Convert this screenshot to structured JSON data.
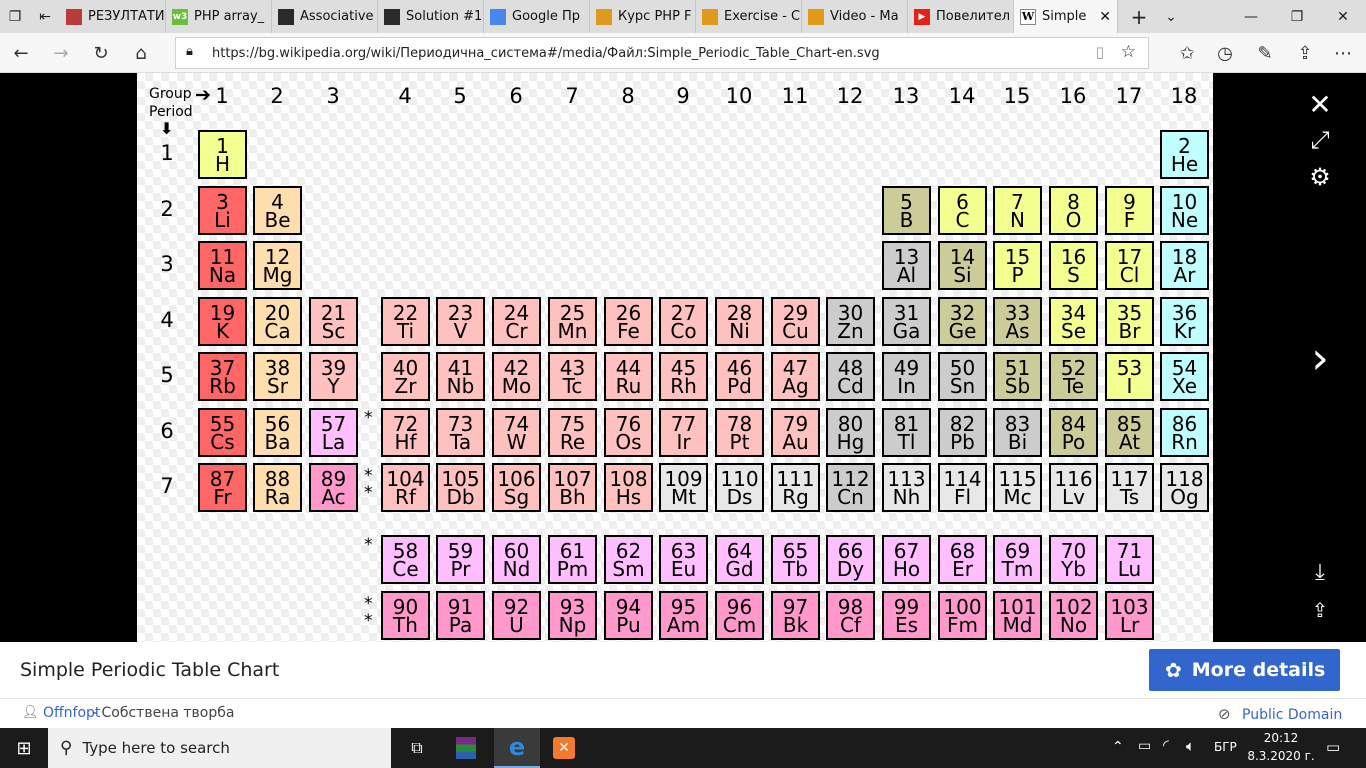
{
  "browser": {
    "tabs": [
      {
        "label": "РЕЗУЛТАТИ",
        "color": "#ba3b3b",
        "glyph": ""
      },
      {
        "label": "PHP array_",
        "color": "#6bbd3e",
        "glyph": "w3"
      },
      {
        "label": "Associative",
        "color": "#2a2a2a",
        "glyph": ""
      },
      {
        "label": "Solution #1",
        "color": "#2a2a2a",
        "glyph": ""
      },
      {
        "label": "Google Пр",
        "color": "#4a86e8",
        "glyph": ""
      },
      {
        "label": "Курс PHP F",
        "color": "#e09a1b",
        "glyph": ""
      },
      {
        "label": "Exercise - С",
        "color": "#e09a1b",
        "glyph": ""
      },
      {
        "label": "Video - Ма",
        "color": "#e09a1b",
        "glyph": ""
      },
      {
        "label": "Повелител",
        "color": "#e62117",
        "glyph": "▶"
      }
    ],
    "active_tab": {
      "label": "Simple",
      "glyph": "W"
    },
    "url": "https://bg.wikipedia.org/wiki/Периодична_система#/media/Файл:Simple_Periodic_Table_Chart-en.svg"
  },
  "table": {
    "group_label": "Group",
    "period_label": "Period",
    "groups": [
      "1",
      "2",
      "3",
      "4",
      "5",
      "6",
      "7",
      "8",
      "9",
      "10",
      "11",
      "12",
      "13",
      "14",
      "15",
      "16",
      "17",
      "18"
    ],
    "periods": [
      "1",
      "2",
      "3",
      "4",
      "5",
      "6",
      "7"
    ],
    "elements": [
      {
        "n": "1",
        "s": "H",
        "g": 1,
        "p": 1,
        "c": "#f3ff8f"
      },
      {
        "n": "2",
        "s": "He",
        "g": 18,
        "p": 1,
        "c": "#c0ffff"
      },
      {
        "n": "3",
        "s": "Li",
        "g": 1,
        "p": 2,
        "c": "#ff6666"
      },
      {
        "n": "4",
        "s": "Be",
        "g": 2,
        "p": 2,
        "c": "#ffdead"
      },
      {
        "n": "5",
        "s": "B",
        "g": 13,
        "p": 2,
        "c": "#cccc99"
      },
      {
        "n": "6",
        "s": "C",
        "g": 14,
        "p": 2,
        "c": "#f3ff8f"
      },
      {
        "n": "7",
        "s": "N",
        "g": 15,
        "p": 2,
        "c": "#f3ff8f"
      },
      {
        "n": "8",
        "s": "O",
        "g": 16,
        "p": 2,
        "c": "#f3ff8f"
      },
      {
        "n": "9",
        "s": "F",
        "g": 17,
        "p": 2,
        "c": "#f3ff8f"
      },
      {
        "n": "10",
        "s": "Ne",
        "g": 18,
        "p": 2,
        "c": "#c0ffff"
      },
      {
        "n": "11",
        "s": "Na",
        "g": 1,
        "p": 3,
        "c": "#ff6666"
      },
      {
        "n": "12",
        "s": "Mg",
        "g": 2,
        "p": 3,
        "c": "#ffdead"
      },
      {
        "n": "13",
        "s": "Al",
        "g": 13,
        "p": 3,
        "c": "#cccccc"
      },
      {
        "n": "14",
        "s": "Si",
        "g": 14,
        "p": 3,
        "c": "#cccc99"
      },
      {
        "n": "15",
        "s": "P",
        "g": 15,
        "p": 3,
        "c": "#f3ff8f"
      },
      {
        "n": "16",
        "s": "S",
        "g": 16,
        "p": 3,
        "c": "#f3ff8f"
      },
      {
        "n": "17",
        "s": "Cl",
        "g": 17,
        "p": 3,
        "c": "#f3ff8f"
      },
      {
        "n": "18",
        "s": "Ar",
        "g": 18,
        "p": 3,
        "c": "#c0ffff"
      },
      {
        "n": "19",
        "s": "K",
        "g": 1,
        "p": 4,
        "c": "#ff6666"
      },
      {
        "n": "20",
        "s": "Ca",
        "g": 2,
        "p": 4,
        "c": "#ffdead"
      },
      {
        "n": "21",
        "s": "Sc",
        "g": 3,
        "p": 4,
        "c": "#ffc0c0"
      },
      {
        "n": "22",
        "s": "Ti",
        "g": 4,
        "p": 4,
        "c": "#ffc0c0"
      },
      {
        "n": "23",
        "s": "V",
        "g": 5,
        "p": 4,
        "c": "#ffc0c0"
      },
      {
        "n": "24",
        "s": "Cr",
        "g": 6,
        "p": 4,
        "c": "#ffc0c0"
      },
      {
        "n": "25",
        "s": "Mn",
        "g": 7,
        "p": 4,
        "c": "#ffc0c0"
      },
      {
        "n": "26",
        "s": "Fe",
        "g": 8,
        "p": 4,
        "c": "#ffc0c0"
      },
      {
        "n": "27",
        "s": "Co",
        "g": 9,
        "p": 4,
        "c": "#ffc0c0"
      },
      {
        "n": "28",
        "s": "Ni",
        "g": 10,
        "p": 4,
        "c": "#ffc0c0"
      },
      {
        "n": "29",
        "s": "Cu",
        "g": 11,
        "p": 4,
        "c": "#ffc0c0"
      },
      {
        "n": "30",
        "s": "Zn",
        "g": 12,
        "p": 4,
        "c": "#cccccc"
      },
      {
        "n": "31",
        "s": "Ga",
        "g": 13,
        "p": 4,
        "c": "#cccccc"
      },
      {
        "n": "32",
        "s": "Ge",
        "g": 14,
        "p": 4,
        "c": "#cccc99"
      },
      {
        "n": "33",
        "s": "As",
        "g": 15,
        "p": 4,
        "c": "#cccc99"
      },
      {
        "n": "34",
        "s": "Se",
        "g": 16,
        "p": 4,
        "c": "#f3ff8f"
      },
      {
        "n": "35",
        "s": "Br",
        "g": 17,
        "p": 4,
        "c": "#f3ff8f"
      },
      {
        "n": "36",
        "s": "Kr",
        "g": 18,
        "p": 4,
        "c": "#c0ffff"
      },
      {
        "n": "37",
        "s": "Rb",
        "g": 1,
        "p": 5,
        "c": "#ff6666"
      },
      {
        "n": "38",
        "s": "Sr",
        "g": 2,
        "p": 5,
        "c": "#ffdead"
      },
      {
        "n": "39",
        "s": "Y",
        "g": 3,
        "p": 5,
        "c": "#ffc0c0"
      },
      {
        "n": "40",
        "s": "Zr",
        "g": 4,
        "p": 5,
        "c": "#ffc0c0"
      },
      {
        "n": "41",
        "s": "Nb",
        "g": 5,
        "p": 5,
        "c": "#ffc0c0"
      },
      {
        "n": "42",
        "s": "Mo",
        "g": 6,
        "p": 5,
        "c": "#ffc0c0"
      },
      {
        "n": "43",
        "s": "Tc",
        "g": 7,
        "p": 5,
        "c": "#ffc0c0"
      },
      {
        "n": "44",
        "s": "Ru",
        "g": 8,
        "p": 5,
        "c": "#ffc0c0"
      },
      {
        "n": "45",
        "s": "Rh",
        "g": 9,
        "p": 5,
        "c": "#ffc0c0"
      },
      {
        "n": "46",
        "s": "Pd",
        "g": 10,
        "p": 5,
        "c": "#ffc0c0"
      },
      {
        "n": "47",
        "s": "Ag",
        "g": 11,
        "p": 5,
        "c": "#ffc0c0"
      },
      {
        "n": "48",
        "s": "Cd",
        "g": 12,
        "p": 5,
        "c": "#cccccc"
      },
      {
        "n": "49",
        "s": "In",
        "g": 13,
        "p": 5,
        "c": "#cccccc"
      },
      {
        "n": "50",
        "s": "Sn",
        "g": 14,
        "p": 5,
        "c": "#cccccc"
      },
      {
        "n": "51",
        "s": "Sb",
        "g": 15,
        "p": 5,
        "c": "#cccc99"
      },
      {
        "n": "52",
        "s": "Te",
        "g": 16,
        "p": 5,
        "c": "#cccc99"
      },
      {
        "n": "53",
        "s": "I",
        "g": 17,
        "p": 5,
        "c": "#f3ff8f"
      },
      {
        "n": "54",
        "s": "Xe",
        "g": 18,
        "p": 5,
        "c": "#c0ffff"
      },
      {
        "n": "55",
        "s": "Cs",
        "g": 1,
        "p": 6,
        "c": "#ff6666"
      },
      {
        "n": "56",
        "s": "Ba",
        "g": 2,
        "p": 6,
        "c": "#ffdead"
      },
      {
        "n": "57",
        "s": "La",
        "g": 3,
        "p": 6,
        "c": "#ffbfff"
      },
      {
        "n": "72",
        "s": "Hf",
        "g": 4,
        "p": 6,
        "c": "#ffc0c0"
      },
      {
        "n": "73",
        "s": "Ta",
        "g": 5,
        "p": 6,
        "c": "#ffc0c0"
      },
      {
        "n": "74",
        "s": "W",
        "g": 6,
        "p": 6,
        "c": "#ffc0c0"
      },
      {
        "n": "75",
        "s": "Re",
        "g": 7,
        "p": 6,
        "c": "#ffc0c0"
      },
      {
        "n": "76",
        "s": "Os",
        "g": 8,
        "p": 6,
        "c": "#ffc0c0"
      },
      {
        "n": "77",
        "s": "Ir",
        "g": 9,
        "p": 6,
        "c": "#ffc0c0"
      },
      {
        "n": "78",
        "s": "Pt",
        "g": 10,
        "p": 6,
        "c": "#ffc0c0"
      },
      {
        "n": "79",
        "s": "Au",
        "g": 11,
        "p": 6,
        "c": "#ffc0c0"
      },
      {
        "n": "80",
        "s": "Hg",
        "g": 12,
        "p": 6,
        "c": "#cccccc"
      },
      {
        "n": "81",
        "s": "Tl",
        "g": 13,
        "p": 6,
        "c": "#cccccc"
      },
      {
        "n": "82",
        "s": "Pb",
        "g": 14,
        "p": 6,
        "c": "#cccccc"
      },
      {
        "n": "83",
        "s": "Bi",
        "g": 15,
        "p": 6,
        "c": "#cccccc"
      },
      {
        "n": "84",
        "s": "Po",
        "g": 16,
        "p": 6,
        "c": "#cccc99"
      },
      {
        "n": "85",
        "s": "At",
        "g": 17,
        "p": 6,
        "c": "#cccc99"
      },
      {
        "n": "86",
        "s": "Rn",
        "g": 18,
        "p": 6,
        "c": "#c0ffff"
      },
      {
        "n": "87",
        "s": "Fr",
        "g": 1,
        "p": 7,
        "c": "#ff6666"
      },
      {
        "n": "88",
        "s": "Ra",
        "g": 2,
        "p": 7,
        "c": "#ffdead"
      },
      {
        "n": "89",
        "s": "Ac",
        "g": 3,
        "p": 7,
        "c": "#ff99cc"
      },
      {
        "n": "104",
        "s": "Rf",
        "g": 4,
        "p": 7,
        "c": "#ffc0c0"
      },
      {
        "n": "105",
        "s": "Db",
        "g": 5,
        "p": 7,
        "c": "#ffc0c0"
      },
      {
        "n": "106",
        "s": "Sg",
        "g": 6,
        "p": 7,
        "c": "#ffc0c0"
      },
      {
        "n": "107",
        "s": "Bh",
        "g": 7,
        "p": 7,
        "c": "#ffc0c0"
      },
      {
        "n": "108",
        "s": "Hs",
        "g": 8,
        "p": 7,
        "c": "#ffc0c0"
      },
      {
        "n": "109",
        "s": "Mt",
        "g": 9,
        "p": 7,
        "c": "#e8e8e8"
      },
      {
        "n": "110",
        "s": "Ds",
        "g": 10,
        "p": 7,
        "c": "#e8e8e8"
      },
      {
        "n": "111",
        "s": "Rg",
        "g": 11,
        "p": 7,
        "c": "#e8e8e8"
      },
      {
        "n": "112",
        "s": "Cn",
        "g": 12,
        "p": 7,
        "c": "#cccccc"
      },
      {
        "n": "113",
        "s": "Nh",
        "g": 13,
        "p": 7,
        "c": "#e8e8e8"
      },
      {
        "n": "114",
        "s": "Fl",
        "g": 14,
        "p": 7,
        "c": "#e8e8e8"
      },
      {
        "n": "115",
        "s": "Mc",
        "g": 15,
        "p": 7,
        "c": "#e8e8e8"
      },
      {
        "n": "116",
        "s": "Lv",
        "g": 16,
        "p": 7,
        "c": "#e8e8e8"
      },
      {
        "n": "117",
        "s": "Ts",
        "g": 17,
        "p": 7,
        "c": "#e8e8e8"
      },
      {
        "n": "118",
        "s": "Og",
        "g": 18,
        "p": 7,
        "c": "#e8e8e8"
      },
      {
        "n": "58",
        "s": "Ce",
        "g": 4,
        "p": 8,
        "c": "#ffbfff"
      },
      {
        "n": "59",
        "s": "Pr",
        "g": 5,
        "p": 8,
        "c": "#ffbfff"
      },
      {
        "n": "60",
        "s": "Nd",
        "g": 6,
        "p": 8,
        "c": "#ffbfff"
      },
      {
        "n": "61",
        "s": "Pm",
        "g": 7,
        "p": 8,
        "c": "#ffbfff"
      },
      {
        "n": "62",
        "s": "Sm",
        "g": 8,
        "p": 8,
        "c": "#ffbfff"
      },
      {
        "n": "63",
        "s": "Eu",
        "g": 9,
        "p": 8,
        "c": "#ffbfff"
      },
      {
        "n": "64",
        "s": "Gd",
        "g": 10,
        "p": 8,
        "c": "#ffbfff"
      },
      {
        "n": "65",
        "s": "Tb",
        "g": 11,
        "p": 8,
        "c": "#ffbfff"
      },
      {
        "n": "66",
        "s": "Dy",
        "g": 12,
        "p": 8,
        "c": "#ffbfff"
      },
      {
        "n": "67",
        "s": "Ho",
        "g": 13,
        "p": 8,
        "c": "#ffbfff"
      },
      {
        "n": "68",
        "s": "Er",
        "g": 14,
        "p": 8,
        "c": "#ffbfff"
      },
      {
        "n": "69",
        "s": "Tm",
        "g": 15,
        "p": 8,
        "c": "#ffbfff"
      },
      {
        "n": "70",
        "s": "Yb",
        "g": 16,
        "p": 8,
        "c": "#ffbfff"
      },
      {
        "n": "71",
        "s": "Lu",
        "g": 17,
        "p": 8,
        "c": "#ffbfff"
      },
      {
        "n": "90",
        "s": "Th",
        "g": 4,
        "p": 9,
        "c": "#ff99cc"
      },
      {
        "n": "91",
        "s": "Pa",
        "g": 5,
        "p": 9,
        "c": "#ff99cc"
      },
      {
        "n": "92",
        "s": "U",
        "g": 6,
        "p": 9,
        "c": "#ff99cc"
      },
      {
        "n": "93",
        "s": "Np",
        "g": 7,
        "p": 9,
        "c": "#ff99cc"
      },
      {
        "n": "94",
        "s": "Pu",
        "g": 8,
        "p": 9,
        "c": "#ff99cc"
      },
      {
        "n": "95",
        "s": "Am",
        "g": 9,
        "p": 9,
        "c": "#ff99cc"
      },
      {
        "n": "96",
        "s": "Cm",
        "g": 10,
        "p": 9,
        "c": "#ff99cc"
      },
      {
        "n": "97",
        "s": "Bk",
        "g": 11,
        "p": 9,
        "c": "#ff99cc"
      },
      {
        "n": "98",
        "s": "Cf",
        "g": 12,
        "p": 9,
        "c": "#ff99cc"
      },
      {
        "n": "99",
        "s": "Es",
        "g": 13,
        "p": 9,
        "c": "#ff99cc"
      },
      {
        "n": "100",
        "s": "Fm",
        "g": 14,
        "p": 9,
        "c": "#ff99cc"
      },
      {
        "n": "101",
        "s": "Md",
        "g": 15,
        "p": 9,
        "c": "#ff99cc"
      },
      {
        "n": "102",
        "s": "No",
        "g": 16,
        "p": 9,
        "c": "#ff99cc"
      },
      {
        "n": "103",
        "s": "Lr",
        "g": 17,
        "p": 9,
        "c": "#ff99cc"
      }
    ],
    "stars": [
      {
        "text": "*",
        "p": 6
      },
      {
        "text": "*\n*",
        "p": 7
      },
      {
        "text": "*",
        "p": 8
      },
      {
        "text": "*\n*",
        "p": 9
      }
    ]
  },
  "caption": {
    "title": "Simple Periodic Table Chart",
    "more_details": "More details",
    "author": "Offnfopt",
    "source": " - Собствена творба",
    "license": "Public Domain"
  },
  "taskbar": {
    "search_placeholder": "Type here to search",
    "lang": "БГР",
    "time": "20:12",
    "date": "8.3.2020 г."
  }
}
